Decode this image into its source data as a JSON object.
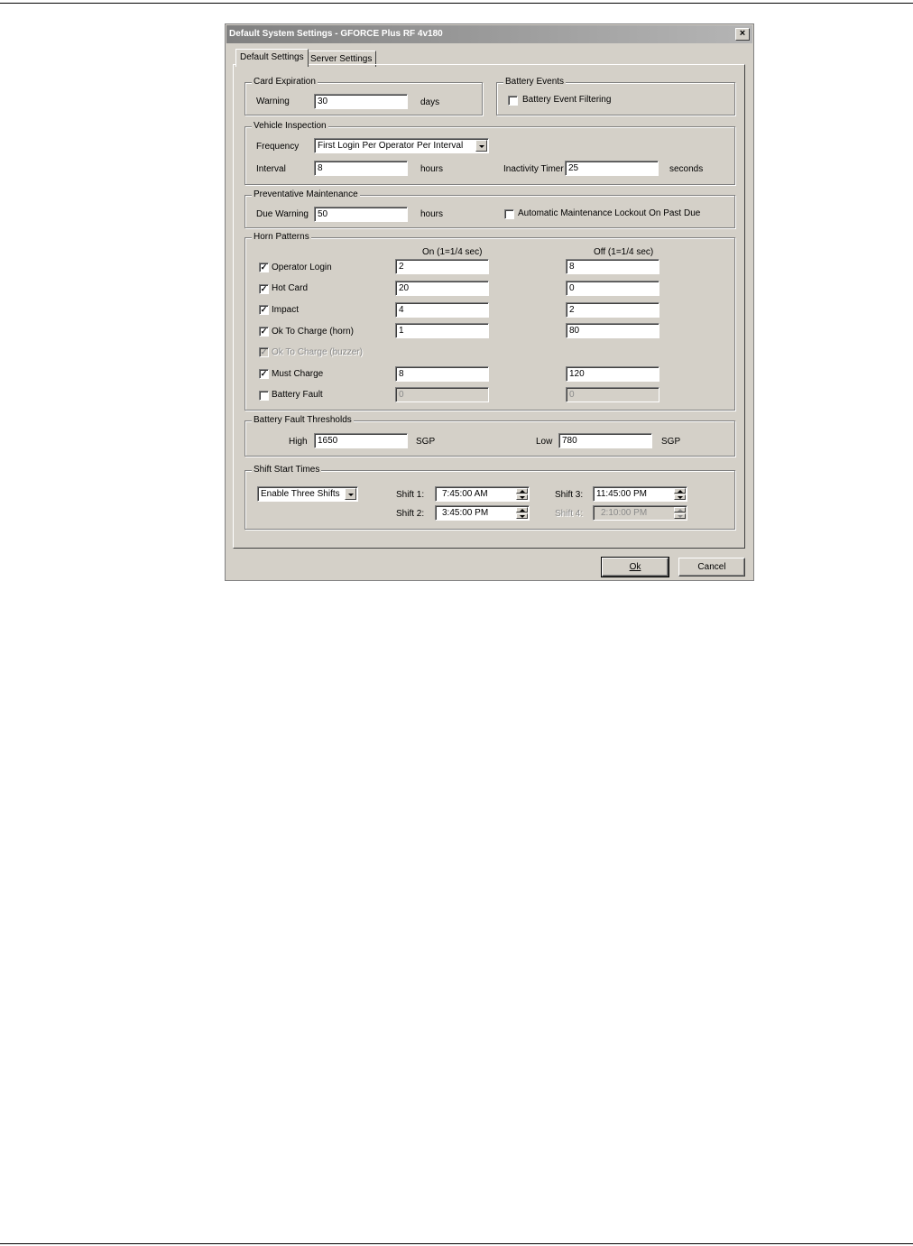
{
  "dialog": {
    "title": "Default System Settings - GFORCE Plus RF 4v180",
    "close_glyph": "×",
    "tabs": [
      {
        "label": "Default Settings",
        "active": true
      },
      {
        "label": "Server Settings",
        "active": false
      }
    ],
    "ok_label": "Ok",
    "cancel_label": "Cancel"
  },
  "card_expiration": {
    "legend": "Card Expiration",
    "warning_label": "Warning",
    "warning_value": "30",
    "unit": "days"
  },
  "battery_events": {
    "legend": "Battery Events",
    "filtering_label": "Battery Event Filtering",
    "filtering_checked": false
  },
  "vehicle_inspection": {
    "legend": "Vehicle Inspection",
    "frequency_label": "Frequency",
    "frequency_value": "First Login Per Operator Per Interval",
    "interval_label": "Interval",
    "interval_value": "8",
    "interval_unit": "hours",
    "inactivity_label": "Inactivity Timer",
    "inactivity_value": "25",
    "inactivity_unit": "seconds"
  },
  "preventative_maintenance": {
    "legend": "Preventative Maintenance",
    "due_warning_label": "Due Warning",
    "due_warning_value": "50",
    "due_warning_unit": "hours",
    "lockout_label": "Automatic Maintenance Lockout On Past Due",
    "lockout_checked": false
  },
  "horn_patterns": {
    "legend": "Horn Patterns",
    "on_header": "On (1=1/4 sec)",
    "off_header": "Off (1=1/4 sec)",
    "rows": [
      {
        "label": "Operator Login",
        "checked": true,
        "enabled": true,
        "on": "2",
        "off": "8"
      },
      {
        "label": "Hot Card",
        "checked": true,
        "enabled": true,
        "on": "20",
        "off": "0"
      },
      {
        "label": "Impact",
        "checked": true,
        "enabled": true,
        "on": "4",
        "off": "2"
      },
      {
        "label": "Ok To Charge (horn)",
        "checked": true,
        "enabled": true,
        "on": "1",
        "off": "80"
      },
      {
        "label": "Ok To Charge (buzzer)",
        "checked": true,
        "enabled": false
      },
      {
        "label": "Must Charge",
        "checked": true,
        "enabled": true,
        "on": "8",
        "off": "120"
      },
      {
        "label": "Battery Fault",
        "checked": false,
        "enabled": true,
        "fields_disabled": true,
        "on": "0",
        "off": "0"
      }
    ]
  },
  "battery_fault_thresholds": {
    "legend": "Battery Fault Thresholds",
    "high_label": "High",
    "high_value": "1650",
    "high_unit": "SGP",
    "low_label": "Low",
    "low_value": "780",
    "low_unit": "SGP"
  },
  "shift_start_times": {
    "legend": "Shift Start Times",
    "mode_value": "Enable Three Shifts",
    "shift1_label": "Shift 1:",
    "shift1_value": "7:45:00 AM",
    "shift2_label": "Shift 2:",
    "shift2_value": "3:45:00 PM",
    "shift3_label": "Shift 3:",
    "shift3_value": "11:45:00 PM",
    "shift4_label": "Shift 4:",
    "shift4_value": "2:10:00 PM"
  }
}
